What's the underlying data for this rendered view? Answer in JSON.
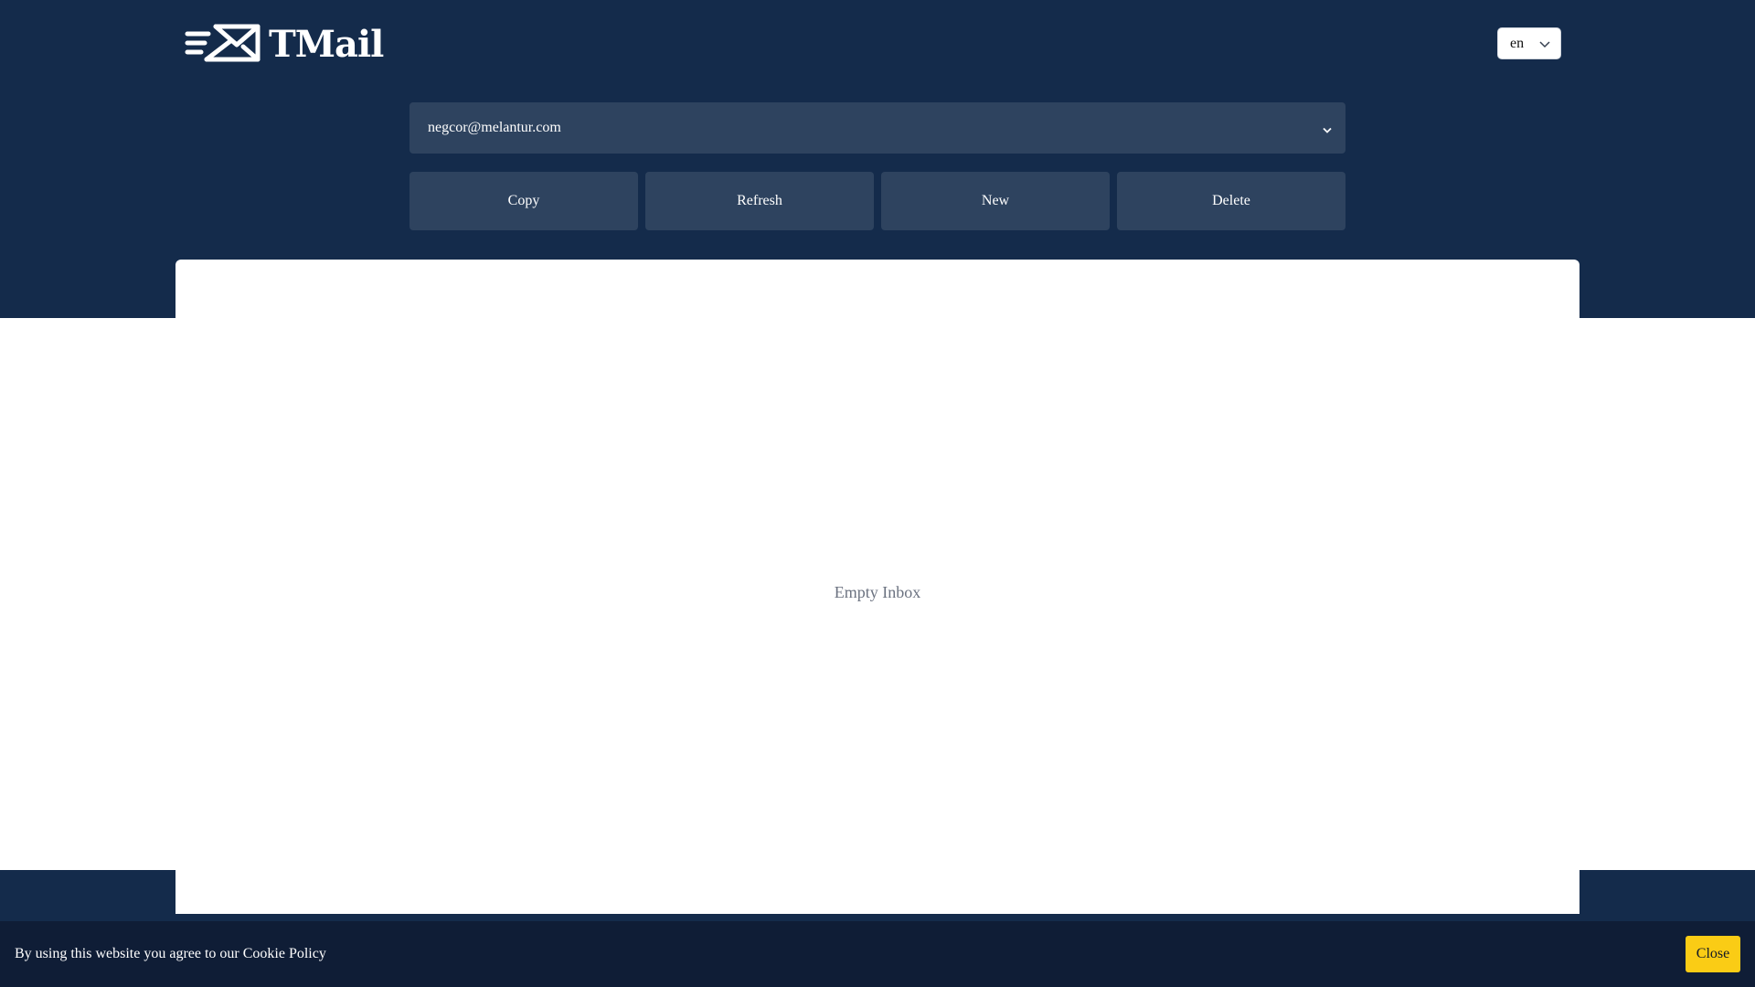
{
  "brand": {
    "name": "TMail",
    "logo_icon": "mail-fast-icon"
  },
  "language": {
    "selected": "en"
  },
  "email": {
    "address": "negcor@melantur.com"
  },
  "actions": {
    "copy_label": "Copy",
    "refresh_label": "Refresh",
    "new_label": "New",
    "delete_label": "Delete"
  },
  "inbox": {
    "empty_text": "Empty Inbox"
  },
  "cookie_banner": {
    "text": "By using this website you agree to our Cookie Policy",
    "close_label": "Close"
  },
  "colors": {
    "header_bg": "#142b4b",
    "control_bg": "#2e435f",
    "cookie_bg": "#0f1d36",
    "close_button": "#facc15"
  }
}
